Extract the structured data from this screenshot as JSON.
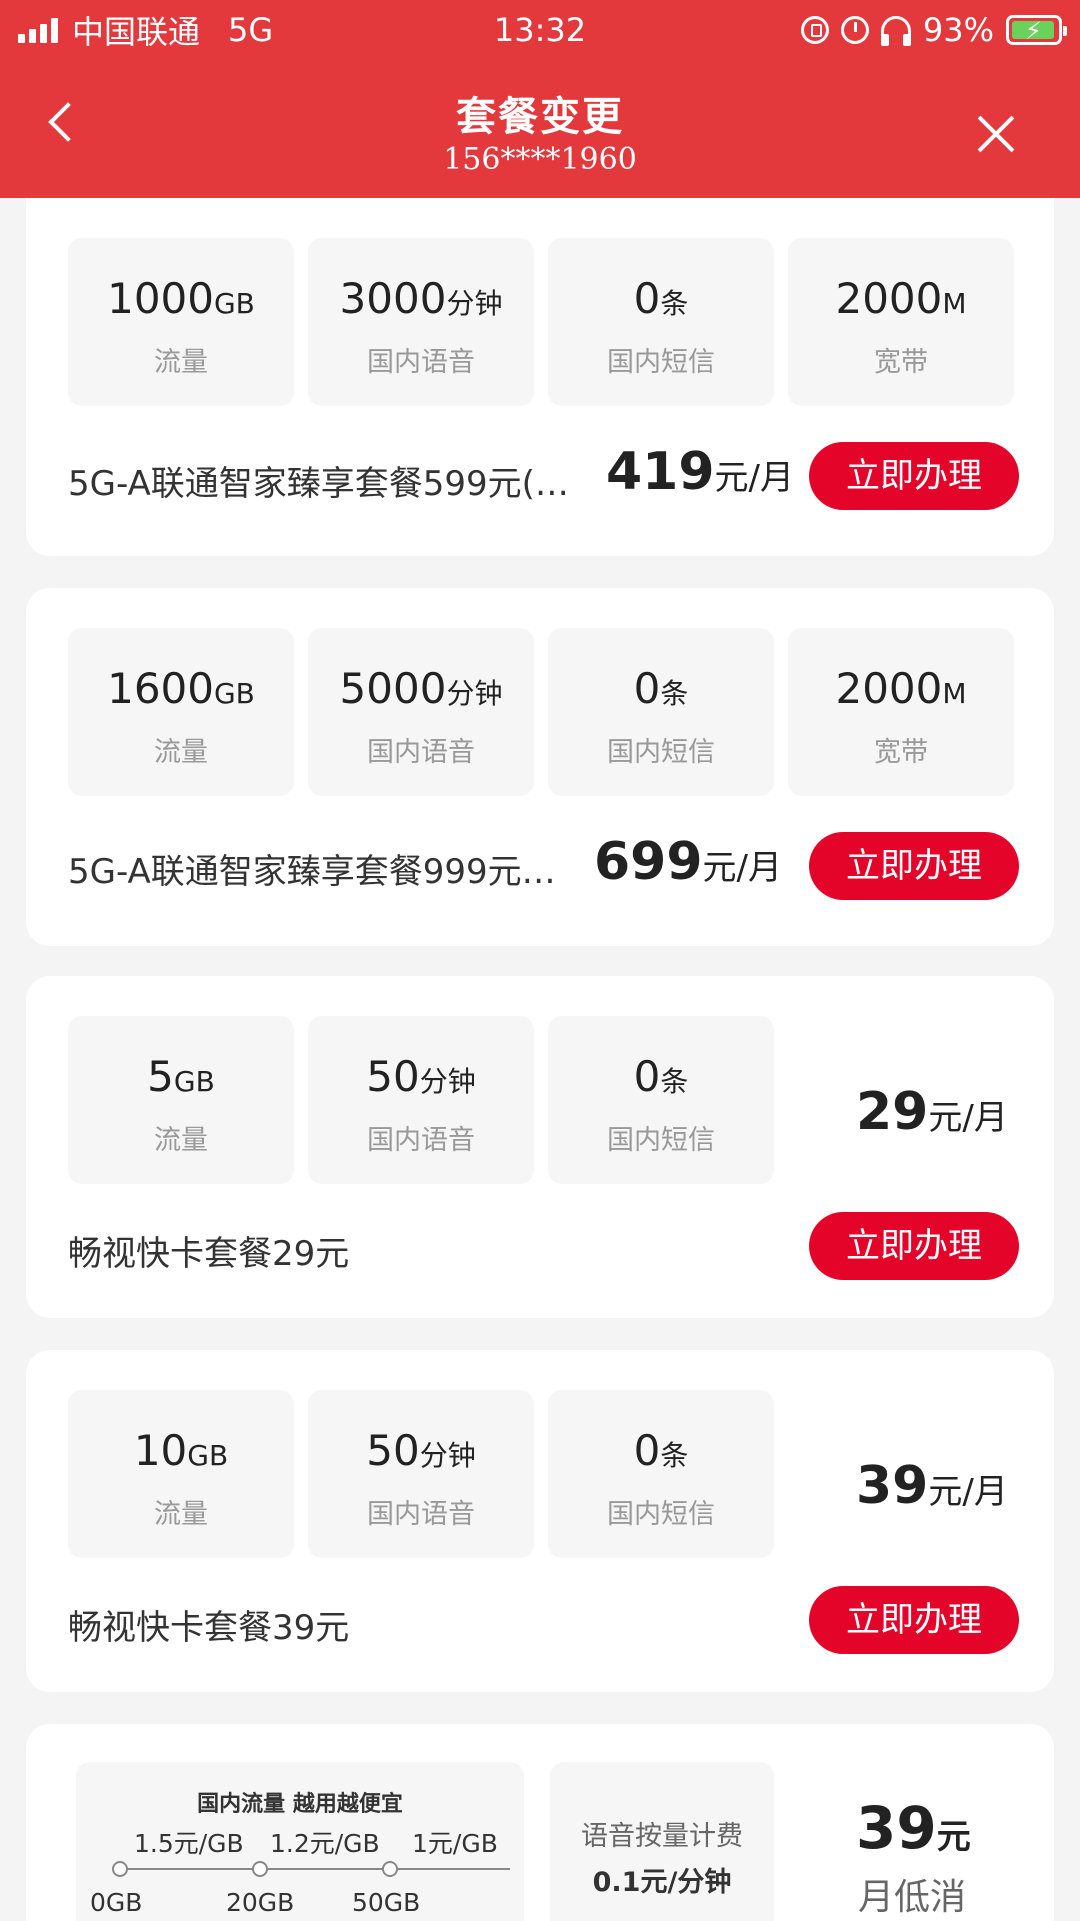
{
  "status_bar": {
    "carrier": "中国联通",
    "network": "5G",
    "time": "13:32",
    "battery": "93%"
  },
  "nav": {
    "title": "套餐变更",
    "phone": "156****1960"
  },
  "plans": [
    {
      "features": [
        {
          "value": "1000",
          "unit": "GB",
          "label": "流量"
        },
        {
          "value": "3000",
          "unit": "分钟",
          "label": "国内语音"
        },
        {
          "value": "0",
          "unit": "条",
          "label": "国内短信"
        },
        {
          "value": "2000",
          "unit": "M",
          "label": "宽带"
        }
      ],
      "name": "5G-A联通智家臻享套餐599元(…",
      "price": "419",
      "price_unit": "元/月",
      "button": "立即办理"
    },
    {
      "features": [
        {
          "value": "1600",
          "unit": "GB",
          "label": "流量"
        },
        {
          "value": "5000",
          "unit": "分钟",
          "label": "国内语音"
        },
        {
          "value": "0",
          "unit": "条",
          "label": "国内短信"
        },
        {
          "value": "2000",
          "unit": "M",
          "label": "宽带"
        }
      ],
      "name": "5G-A联通智家臻享套餐999元…",
      "price": "699",
      "price_unit": "元/月",
      "button": "立即办理"
    },
    {
      "features": [
        {
          "value": "5",
          "unit": "GB",
          "label": "流量"
        },
        {
          "value": "50",
          "unit": "分钟",
          "label": "国内语音"
        },
        {
          "value": "0",
          "unit": "条",
          "label": "国内短信"
        }
      ],
      "name": "畅视快卡套餐29元",
      "price": "29",
      "price_unit": "元/月",
      "button": "立即办理"
    },
    {
      "features": [
        {
          "value": "10",
          "unit": "GB",
          "label": "流量"
        },
        {
          "value": "50",
          "unit": "分钟",
          "label": "国内语音"
        },
        {
          "value": "0",
          "unit": "条",
          "label": "国内短信"
        }
      ],
      "name": "畅视快卡套餐39元",
      "price": "39",
      "price_unit": "元/月",
      "button": "立即办理"
    }
  ],
  "tier_card": {
    "tier_title": "国内流量 越用越便宜",
    "tier_prices": [
      "1.5元/GB",
      "1.2元/GB",
      "1元/GB"
    ],
    "tier_thresholds": [
      "0GB",
      "20GB",
      "50GB"
    ],
    "voice_title": "语音按量计费",
    "voice_rate": "0.1元/分钟",
    "min_price": "39",
    "min_price_unit": "元",
    "min_label": "月低消"
  },
  "colors": {
    "header": "#e4393c",
    "button": "#e4042a"
  }
}
